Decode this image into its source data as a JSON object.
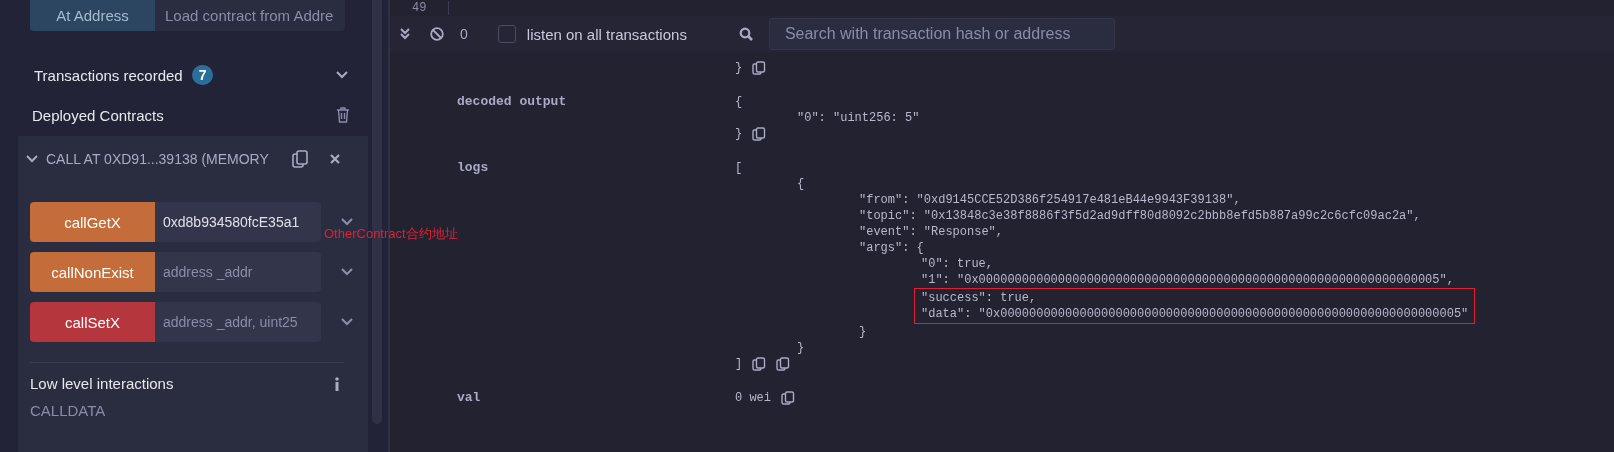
{
  "left_panel": {
    "at_address": {
      "button": "At Address",
      "placeholder": "Load contract from Addre"
    },
    "transactions": {
      "label": "Transactions recorded",
      "count": "7",
      "expanded": false
    },
    "deployed_title": "Deployed Contracts",
    "contract": {
      "title": "CALL AT 0XD91...39138 (MEMORY",
      "expanded": true,
      "functions": [
        {
          "name": "callGetX",
          "kind": "nonpayable",
          "value": "0xd8b934580fcE35a1"
        },
        {
          "name": "callNonExist",
          "kind": "nonpayable",
          "placeholder": "address _addr"
        },
        {
          "name": "callSetX",
          "kind": "payable",
          "placeholder": "address _addr, uint25"
        }
      ],
      "low_level": {
        "title": "Low level interactions",
        "calldata": "CALLDATA"
      }
    }
  },
  "annotation": {
    "text": "OtherContract合约地址"
  },
  "editor": {
    "line_number": "49"
  },
  "terminal": {
    "toolbar": {
      "count": "0",
      "listen_checked": false,
      "listen_label": "listen on all transactions",
      "search_placeholder": "Search with transaction hash or address"
    },
    "rows": [
      {
        "value": [
          {
            "text": "}",
            "actions": [
              {
                "kind": "copy"
              }
            ]
          }
        ]
      },
      {
        "label": "decoded output",
        "value": [
          {
            "open": "{",
            "children": [
              {
                "text": "\"0\": \"uint256: 5\""
              }
            ],
            "close": "}",
            "actions": [
              {
                "kind": "copy"
              }
            ]
          }
        ]
      },
      {
        "label": "logs",
        "value": [
          {
            "open": "[",
            "children": [
              {
                "open": "{",
                "children": [
                  {
                    "text": "\"from\": \"0xd9145CCE52D386f254917e481eB44e9943F39138\","
                  },
                  {
                    "text": "\"topic\": \"0x13848c3e38f8886f3f5d2ad9dff80d8092c2bbb8efd5b887a99c2c6cfc09ac2a\","
                  },
                  {
                    "text": "\"event\": \"Response\","
                  },
                  {
                    "open": "\"args\": {",
                    "children": [
                      {
                        "text": "\"0\": true,"
                      },
                      {
                        "text": "\"1\": \"0x0000000000000000000000000000000000000000000000000000000000000005\","
                      },
                      {
                        "kind": "highlight",
                        "children": [
                          {
                            "text": "\"success\": true,"
                          },
                          {
                            "text": "\"data\": \"0x0000000000000000000000000000000000000000000000000000000000000005\""
                          }
                        ]
                      }
                    ],
                    "close": "}"
                  }
                ],
                "close": "}"
              }
            ],
            "close": "]",
            "actions": [
              {
                "kind": "copy"
              },
              {
                "kind": "copy"
              }
            ]
          }
        ]
      },
      {
        "label": "val",
        "value": [
          {
            "text": "0 wei",
            "actions": [
              {
                "kind": "copy"
              }
            ]
          }
        ]
      }
    ]
  }
}
